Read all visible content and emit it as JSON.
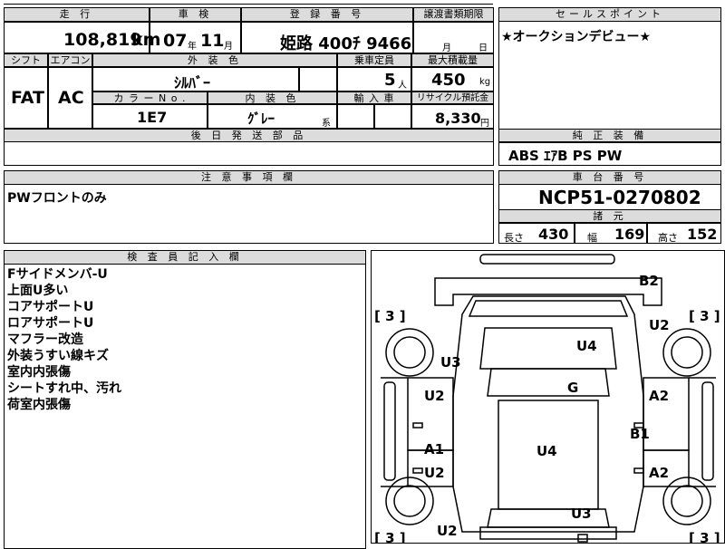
{
  "header": {
    "mileage_label": "走 行",
    "inspection_label": "車 検",
    "registration_label": "登 録 番 号",
    "transfer_label": "譲渡書類期限",
    "sales_point_label": "セールスポイント",
    "mileage_value": "108,819",
    "mileage_unit": "km",
    "inspection_year": "07",
    "year_unit": "年",
    "inspection_month": "11",
    "month_unit": "月",
    "registration_value": "姫路 400ﾁ 9466",
    "transfer_month_unit": "月",
    "transfer_day_unit": "日"
  },
  "specs": {
    "shift_label": "シフト",
    "aircon_label": "エアコン",
    "exterior_color_label": "外 装 色",
    "capacity_label": "乗車定員",
    "max_load_label": "最大積載量",
    "shift_value": "FAT",
    "aircon_value": "AC",
    "exterior_color_value": "ｼﾙﾊﾞｰ",
    "capacity_value": "5",
    "capacity_unit": "人",
    "max_load_value": "450",
    "max_load_unit": "kg",
    "color_no_label": "カ ラ ー N o .",
    "interior_color_label": "内 装 色",
    "import_label": "輸 入 車",
    "recycle_label": "リサイクル預託金",
    "color_no_value": "1E7",
    "interior_color_value": "ｸﾞﾚｰ",
    "interior_suffix": "系",
    "recycle_value": "8,330",
    "recycle_unit": "円",
    "later_parts_label": "後 日 発 送 部 品"
  },
  "sales_point": {
    "text": "★オークションデビュー★"
  },
  "equipment": {
    "label": "純 正 装 備",
    "value": "ABS ｴｱB PS PW"
  },
  "notes": {
    "label": "注 意 事 項 欄",
    "text": "PWフロントのみ"
  },
  "chassis": {
    "label": "車 台 番 号",
    "value": "NCP51-0270802",
    "dims_label": "諸 元",
    "length_label": "長さ",
    "length_value": "430",
    "width_label": "幅",
    "width_value": "169",
    "height_label": "高さ",
    "height_value": "152"
  },
  "inspector": {
    "label": "検 査 員 記 入 欄",
    "lines": [
      "Fサイドメンバ-U",
      "上面U多い",
      "コアサポートU",
      "ロアサポートU",
      "マフラー改造",
      "外装うすい線キズ",
      "室内内張傷",
      "シートすれ中、汚れ",
      "荷室内張傷"
    ]
  },
  "diagram": {
    "marks": {
      "b2": "B2",
      "tire_fl": "[ 3 ]",
      "tire_fr": "[ 3 ]",
      "u2_fr": "U2",
      "u4_hood": "U4",
      "u3_fl": "U3",
      "g": "G",
      "u2_fl_door": "U2",
      "a2_fr_door": "A2",
      "b1": "B1",
      "a1_rl_door": "A1",
      "u4_roof": "U4",
      "u2_rl_door": "U2",
      "a2_rr_door": "A2",
      "u3_trunk": "U3",
      "tire_rl": "[ 3 ]",
      "u2_rear": "U2",
      "tire_rr": "[ 3 ]"
    }
  }
}
